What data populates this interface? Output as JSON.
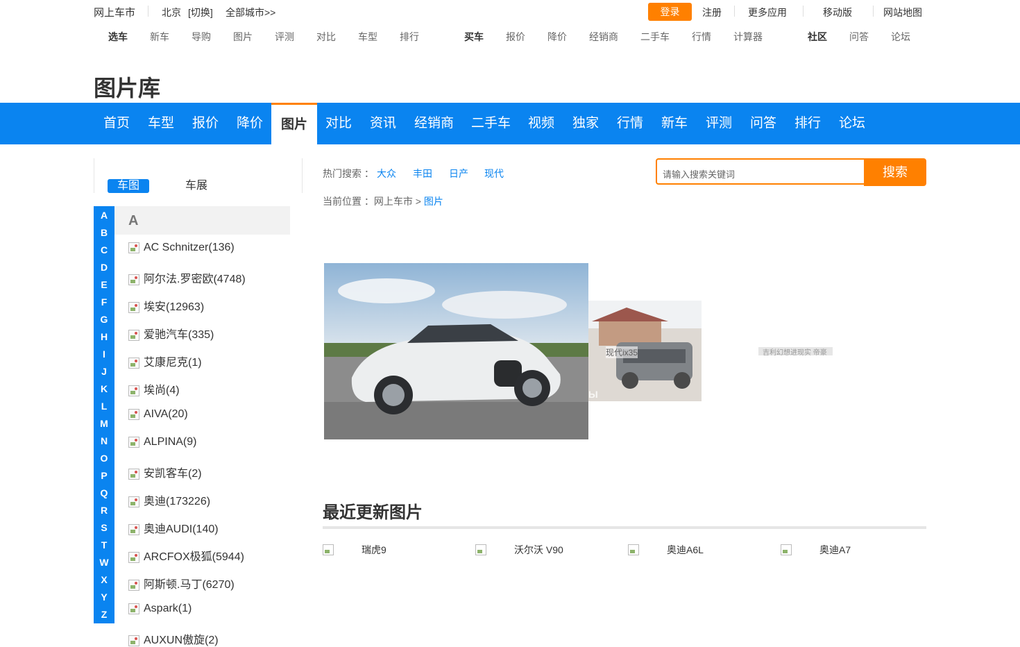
{
  "topbar": {
    "site": "网上车市",
    "city": "北京",
    "switch": "[切换]",
    "all_cities": "全部城市>>",
    "login": "登录",
    "register": "注册",
    "more_apps": "更多应用",
    "mobile": "移动版",
    "sitemap": "网站地图"
  },
  "subnav": {
    "select_car": {
      "title": "选车",
      "items": [
        "新车",
        "导购",
        "图片",
        "评测",
        "对比",
        "车型",
        "排行"
      ]
    },
    "buy_car": {
      "title": "买车",
      "items": [
        "报价",
        "降价",
        "经销商",
        "二手车",
        "行情",
        "计算器"
      ]
    },
    "community": {
      "title": "社区",
      "items": [
        "问答",
        "论坛"
      ]
    }
  },
  "page_title": "图片库",
  "main_nav": [
    "首页",
    "车型",
    "报价",
    "降价",
    "图片",
    "对比",
    "资讯",
    "经销商",
    "二手车",
    "视频",
    "独家",
    "行情",
    "新车",
    "评测",
    "问答",
    "排行",
    "论坛"
  ],
  "main_nav_active": "图片",
  "side_tabs": {
    "active": "车图",
    "other": "车展"
  },
  "letters": [
    "A",
    "B",
    "C",
    "D",
    "E",
    "F",
    "G",
    "H",
    "I",
    "J",
    "K",
    "L",
    "M",
    "N",
    "O",
    "P",
    "Q",
    "R",
    "S",
    "T",
    "W",
    "X",
    "Y",
    "Z"
  ],
  "group_letter": "A",
  "brands": [
    "AC Schnitzer(136)",
    "阿尔法.罗密欧(4748)",
    "埃安(12963)",
    "爱驰汽车(335)",
    "艾康尼克(1)",
    "埃尚(4)",
    "AIVA(20)",
    "ALPINA(9)",
    "安凯客车(2)",
    "奥迪(173226)",
    "奥迪AUDI(140)",
    "ARCFOX极狐(5944)",
    "阿斯顿.马丁(6270)",
    "Aspark(1)",
    "AUXUN傲旋(2)"
  ],
  "search": {
    "hot_label": "热门搜索 ：",
    "hot_items": [
      "大众",
      "丰田",
      "日产",
      "现代"
    ],
    "placeholder": "请输入搜索关键词",
    "button": "搜索"
  },
  "breadcrumb": {
    "prefix": "当前位置 ：网上车市 > ",
    "current": "图片"
  },
  "carousel": {
    "slide2_alt": "现代ix35",
    "slide3_alt": "吉利幻想进现实 帝豪",
    "watermark": "ТраницЫ"
  },
  "recent": {
    "title": "最近更新图片",
    "items": [
      "瑞虎9",
      "沃尔沃 V90",
      "奥迪A6L",
      "奥迪A7"
    ]
  }
}
